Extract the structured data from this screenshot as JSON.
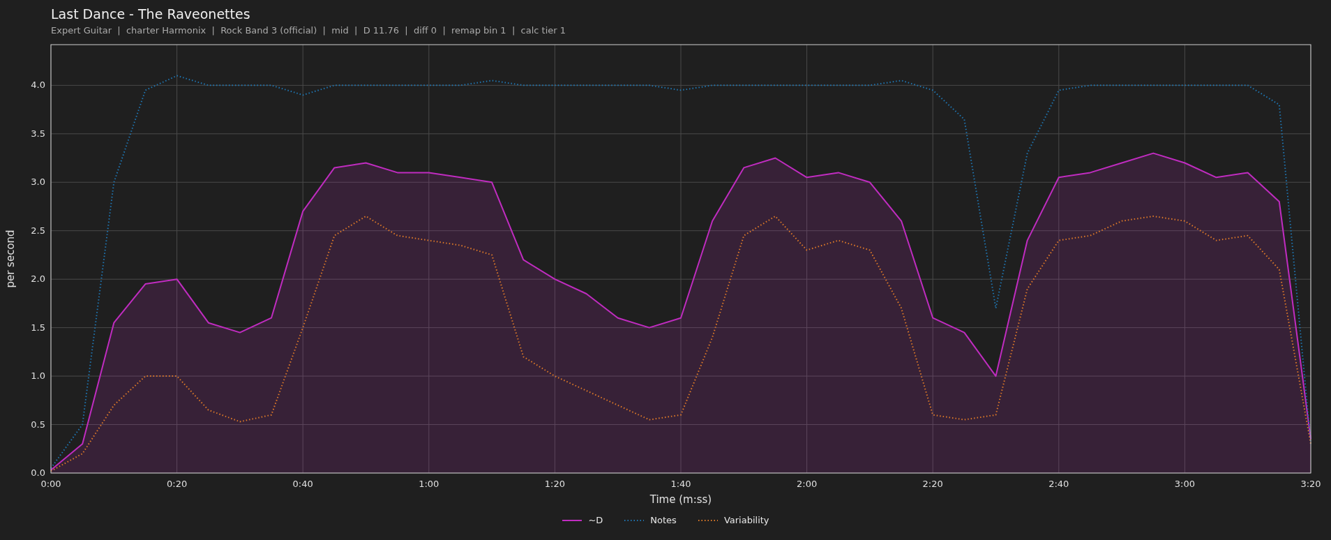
{
  "title": "Last Dance - The Raveonettes",
  "subtitle": "Expert Guitar  |  charter Harmonix  |  Rock Band 3 (official)  |  mid  |  D 11.76  |  diff 0  |  remap bin 1  |  calc tier 1",
  "chart_data": {
    "type": "line",
    "xlabel": "Time (m:ss)",
    "ylabel": "per second",
    "x": [
      0,
      5,
      10,
      15,
      20,
      25,
      30,
      35,
      40,
      45,
      50,
      55,
      60,
      65,
      70,
      75,
      80,
      85,
      90,
      95,
      100,
      105,
      110,
      115,
      120,
      125,
      130,
      135,
      140,
      145,
      150,
      155,
      160,
      165,
      170,
      175,
      180,
      185,
      190,
      195,
      200
    ],
    "series": [
      {
        "name": "~D",
        "color": "#c02cc0",
        "type": "area",
        "line_style": "solid",
        "values": [
          0.03,
          0.3,
          1.55,
          1.95,
          2.0,
          1.55,
          1.45,
          1.6,
          2.7,
          3.15,
          3.2,
          3.1,
          3.1,
          3.05,
          3.0,
          2.2,
          2.0,
          1.85,
          1.6,
          1.5,
          1.6,
          2.6,
          3.15,
          3.25,
          3.05,
          3.1,
          3.0,
          2.6,
          1.6,
          1.45,
          1.0,
          2.4,
          3.05,
          3.1,
          3.2,
          3.3,
          3.2,
          3.05,
          3.1,
          2.8,
          0.35
        ]
      },
      {
        "name": "Notes",
        "color": "#1f77b4",
        "type": "line",
        "line_style": "dotted",
        "values": [
          0.05,
          0.5,
          3.0,
          3.95,
          4.1,
          4.0,
          4.0,
          4.0,
          3.9,
          4.0,
          4.0,
          4.0,
          4.0,
          4.0,
          4.05,
          4.0,
          4.0,
          4.0,
          4.0,
          4.0,
          3.95,
          4.0,
          4.0,
          4.0,
          4.0,
          4.0,
          4.0,
          4.05,
          3.95,
          3.65,
          1.7,
          3.3,
          3.95,
          4.0,
          4.0,
          4.0,
          4.0,
          4.0,
          4.0,
          3.8,
          0.3
        ]
      },
      {
        "name": "Variability",
        "color": "#e07b28",
        "type": "line",
        "line_style": "dotted",
        "values": [
          0.02,
          0.2,
          0.7,
          1.0,
          1.0,
          0.65,
          0.53,
          0.6,
          1.5,
          2.45,
          2.65,
          2.45,
          2.4,
          2.35,
          2.25,
          1.2,
          1.0,
          0.85,
          0.7,
          0.55,
          0.6,
          1.4,
          2.45,
          2.65,
          2.3,
          2.4,
          2.3,
          1.7,
          0.6,
          0.55,
          0.6,
          1.9,
          2.4,
          2.45,
          2.6,
          2.65,
          2.6,
          2.4,
          2.45,
          2.1,
          0.3
        ]
      }
    ],
    "grid": true,
    "xlim": [
      0,
      200
    ],
    "ylim": [
      0,
      4.42
    ],
    "xticks": [
      {
        "value": 0,
        "label": "0:00"
      },
      {
        "value": 20,
        "label": "0:20"
      },
      {
        "value": 40,
        "label": "0:40"
      },
      {
        "value": 60,
        "label": "1:00"
      },
      {
        "value": 80,
        "label": "1:20"
      },
      {
        "value": 100,
        "label": "1:40"
      },
      {
        "value": 120,
        "label": "2:00"
      },
      {
        "value": 140,
        "label": "2:20"
      },
      {
        "value": 160,
        "label": "2:40"
      },
      {
        "value": 180,
        "label": "3:00"
      },
      {
        "value": 200,
        "label": "3:20"
      }
    ],
    "yticks": [
      {
        "value": 0,
        "label": "0.0"
      },
      {
        "value": 0.5,
        "label": "0.5"
      },
      {
        "value": 1,
        "label": "1.0"
      },
      {
        "value": 1.5,
        "label": "1.5"
      },
      {
        "value": 2,
        "label": "2.0"
      },
      {
        "value": 2.5,
        "label": "2.5"
      },
      {
        "value": 3,
        "label": "3.0"
      },
      {
        "value": 3.5,
        "label": "3.5"
      },
      {
        "value": 4,
        "label": "4.0"
      }
    ]
  }
}
